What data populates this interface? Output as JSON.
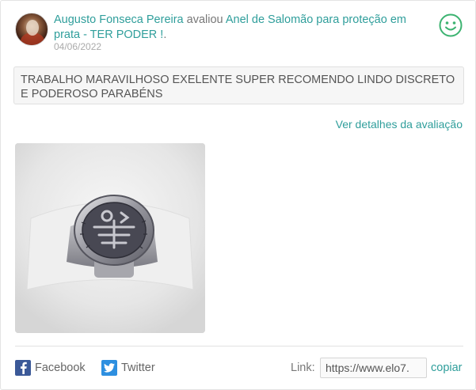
{
  "review": {
    "user_name": "Augusto Fonseca Pereira",
    "action_text": "avaliou",
    "product_name": "Anel de Salomão para proteção em prata - TER PODER !",
    "product_suffix": ".",
    "date": "04/06/2022",
    "text": "TRABALHO MARAVILHOSO EXELENTE SUPER RECOMENDO LINDO DISCRETO E PODEROSO PARABÉNS",
    "details_link": "Ver detalhes da avaliação",
    "sentiment_icon": "smiley-icon",
    "accent_color": "#2f9e9b"
  },
  "share": {
    "facebook_label": "Facebook",
    "twitter_label": "Twitter",
    "link_label": "Link:",
    "link_value": "https://www.elo7.",
    "copy_label": "copiar"
  }
}
